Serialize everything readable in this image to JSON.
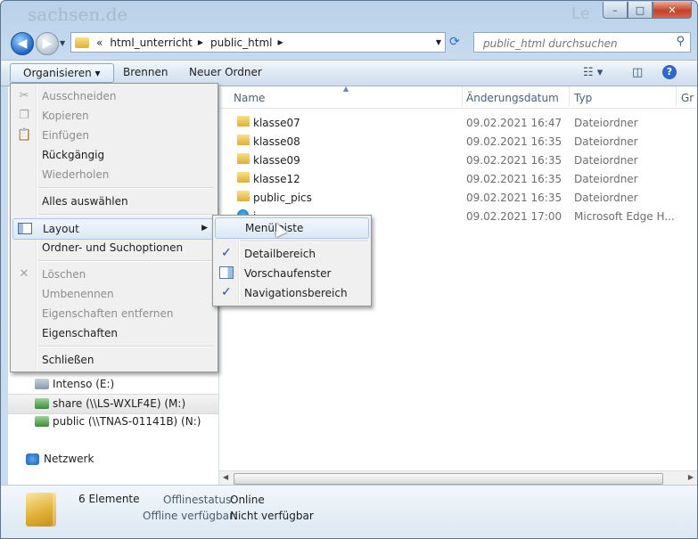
{
  "title_ghost": "sachsen.de",
  "title_ghost2": "Le",
  "window_buttons": {
    "minimize": "–",
    "maximize": "□",
    "close": "✕"
  },
  "address": {
    "prefix": "«",
    "crumbs": [
      "html_unterricht",
      "public_html"
    ],
    "search_placeholder": "public_html durchsuchen"
  },
  "toolbar": {
    "organize": "Organisieren ▾",
    "burn": "Brennen",
    "new_folder": "Neuer Ordner"
  },
  "columns": {
    "name": "Name",
    "date": "Änderungsdatum",
    "type": "Typ",
    "size": "Gr"
  },
  "files": [
    {
      "name": "klasse07",
      "date": "09.02.2021 16:47",
      "type": "Dateiordner",
      "icon": "folder-icon"
    },
    {
      "name": "klasse08",
      "date": "09.02.2021 16:35",
      "type": "Dateiordner",
      "icon": "folder-icon"
    },
    {
      "name": "klasse09",
      "date": "09.02.2021 16:35",
      "type": "Dateiordner",
      "icon": "folder-icon"
    },
    {
      "name": "klasse12",
      "date": "09.02.2021 16:35",
      "type": "Dateiordner",
      "icon": "folder-icon"
    },
    {
      "name": "public_pics",
      "date": "09.02.2021 16:35",
      "type": "Dateiordner",
      "icon": "folder-icon"
    },
    {
      "name": "i...",
      "date": "09.02.2021 17:00",
      "type": "Microsoft Edge H...",
      "icon": "edge-icon"
    }
  ],
  "nav": {
    "drives": [
      {
        "label": "Intenso (E:)",
        "selected": false
      },
      {
        "label": "share (\\\\LS-WXLF4E) (M:)",
        "selected": true
      },
      {
        "label": "public (\\\\TNAS-01141B) (N:)",
        "selected": false
      }
    ],
    "network": "Netzwerk"
  },
  "menu": {
    "items": [
      {
        "label": "Ausschneiden",
        "disabled": true,
        "icon": "cut-icon"
      },
      {
        "label": "Kopieren",
        "disabled": true,
        "icon": "copy-icon"
      },
      {
        "label": "Einfügen",
        "disabled": true,
        "icon": "paste-icon"
      },
      {
        "label": "Rückgängig",
        "disabled": false
      },
      {
        "label": "Wiederholen",
        "disabled": true
      },
      {
        "label": "Alles auswählen",
        "disabled": false
      },
      {
        "label": "Layout",
        "disabled": false,
        "icon": "layout-icon",
        "submenu": true
      },
      {
        "label": "Ordner- und Suchoptionen",
        "disabled": false
      },
      {
        "label": "Löschen",
        "disabled": true,
        "icon": "delete-icon"
      },
      {
        "label": "Umbenennen",
        "disabled": true
      },
      {
        "label": "Eigenschaften entfernen",
        "disabled": true
      },
      {
        "label": "Eigenschaften",
        "disabled": false
      },
      {
        "label": "Schließen",
        "disabled": false
      }
    ]
  },
  "submenu": {
    "items": [
      {
        "label": "Menüleiste",
        "checked": false
      },
      {
        "label": "Detailbereich",
        "checked": true
      },
      {
        "label": "Vorschaufenster",
        "checked": false,
        "icon": "preview-pane-icon"
      },
      {
        "label": "Navigationsbereich",
        "checked": true
      }
    ]
  },
  "status": {
    "count": "6 Elemente",
    "offline_status_label": "Offlinestatus:",
    "offline_status_value": "Online",
    "offline_avail_label": "Offline verfügbar:",
    "offline_avail_value": "Nicht verfügbar"
  }
}
